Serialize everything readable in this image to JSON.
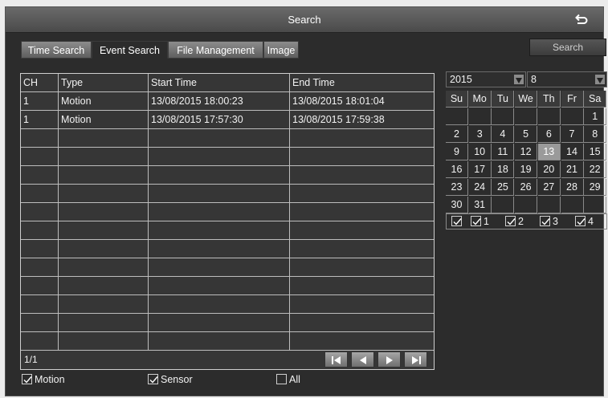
{
  "window": {
    "title": "Search"
  },
  "tabs": [
    {
      "label": "Time Search"
    },
    {
      "label": "Event Search"
    },
    {
      "label": "File Management"
    },
    {
      "label": "Image"
    }
  ],
  "search_button": "Search",
  "table": {
    "headers": [
      "CH",
      "Type",
      "Start Time",
      "End Time"
    ],
    "rows": [
      [
        "1",
        "Motion",
        "13/08/2015 18:00:23",
        "13/08/2015 18:01:04"
      ],
      [
        "1",
        "Motion",
        "13/08/2015 17:57:30",
        "13/08/2015 17:59:38"
      ]
    ],
    "page": "1/1"
  },
  "filters": [
    {
      "label": "Motion",
      "checked": true
    },
    {
      "label": "Sensor",
      "checked": true
    },
    {
      "label": "All",
      "checked": false
    }
  ],
  "calendar": {
    "year": "2015",
    "month": "8",
    "weekdays": [
      "Su",
      "Mo",
      "Tu",
      "We",
      "Th",
      "Fr",
      "Sa"
    ],
    "days": [
      "",
      "",
      "",
      "",
      "",
      "",
      "1",
      "2",
      "3",
      "4",
      "5",
      "6",
      "7",
      "8",
      "9",
      "10",
      "11",
      "12",
      "13",
      "14",
      "15",
      "16",
      "17",
      "18",
      "19",
      "20",
      "21",
      "22",
      "23",
      "24",
      "25",
      "26",
      "27",
      "28",
      "29",
      "30",
      "31",
      "",
      "",
      "",
      "",
      ""
    ],
    "selected_day": "13"
  },
  "channels": [
    {
      "label": "",
      "checked": true
    },
    {
      "label": "1",
      "checked": true
    },
    {
      "label": "2",
      "checked": true
    },
    {
      "label": "3",
      "checked": true
    },
    {
      "label": "4",
      "checked": true
    }
  ]
}
